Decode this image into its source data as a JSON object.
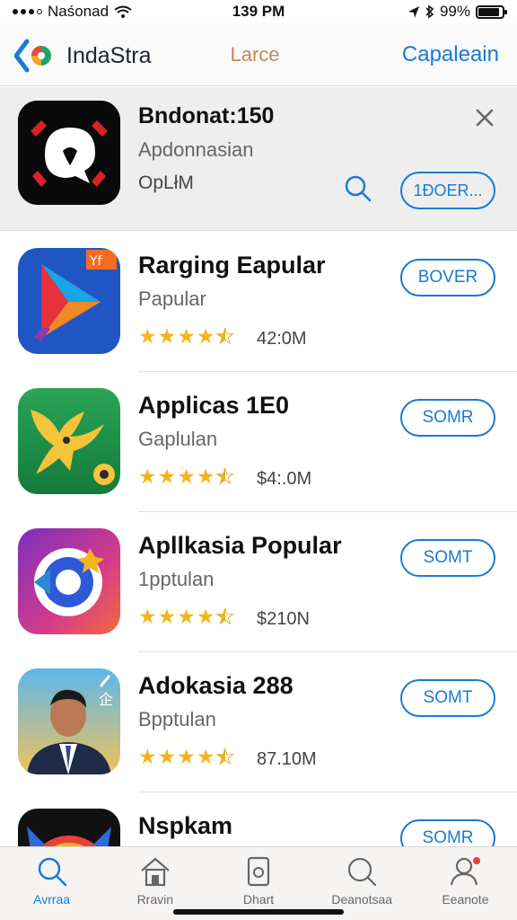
{
  "status_bar": {
    "carrier": "Naśonad",
    "time": "139 PM",
    "battery": "99%"
  },
  "nav": {
    "title": "IndaStra",
    "center": "Larce",
    "right": "Capaleain"
  },
  "featured": {
    "title": "Bndonat:150",
    "subtitle": "Apdonnasian",
    "secondary": "OpLłM",
    "action_label": "1ĐOER..."
  },
  "apps": [
    {
      "title": "Rarging Eapular",
      "subtitle": "Papular",
      "rating": 4.5,
      "meta": "42:0M",
      "button": "BOVER"
    },
    {
      "title": "Applicas 1E0",
      "subtitle": "Gaplulan",
      "rating": 4.5,
      "meta": "$4:.0M",
      "button": "SOMR"
    },
    {
      "title": "Apllkasia Popular",
      "subtitle": "1pptulan",
      "rating": 4.5,
      "meta": "$210N",
      "button": "SOMT"
    },
    {
      "title": "Adokasia 288",
      "subtitle": "Bpptulan",
      "rating": 4.5,
      "meta": "87.10M",
      "button": "SOMT"
    },
    {
      "title": "Nspkam",
      "subtitle": "",
      "rating": null,
      "meta": "",
      "button": "SOMR"
    }
  ],
  "tabs": [
    {
      "label": "Avrraa",
      "icon": "search-icon",
      "active": true
    },
    {
      "label": "Rravin",
      "icon": "home-icon",
      "active": false
    },
    {
      "label": "Dhart",
      "icon": "phone-icon",
      "active": false
    },
    {
      "label": "Deanotsaa",
      "icon": "magnifier-icon",
      "active": false
    },
    {
      "label": "Eeanote",
      "icon": "profile-icon",
      "active": false
    }
  ],
  "colors": {
    "accent": "#1a7ad4",
    "star": "#f4b41c"
  }
}
